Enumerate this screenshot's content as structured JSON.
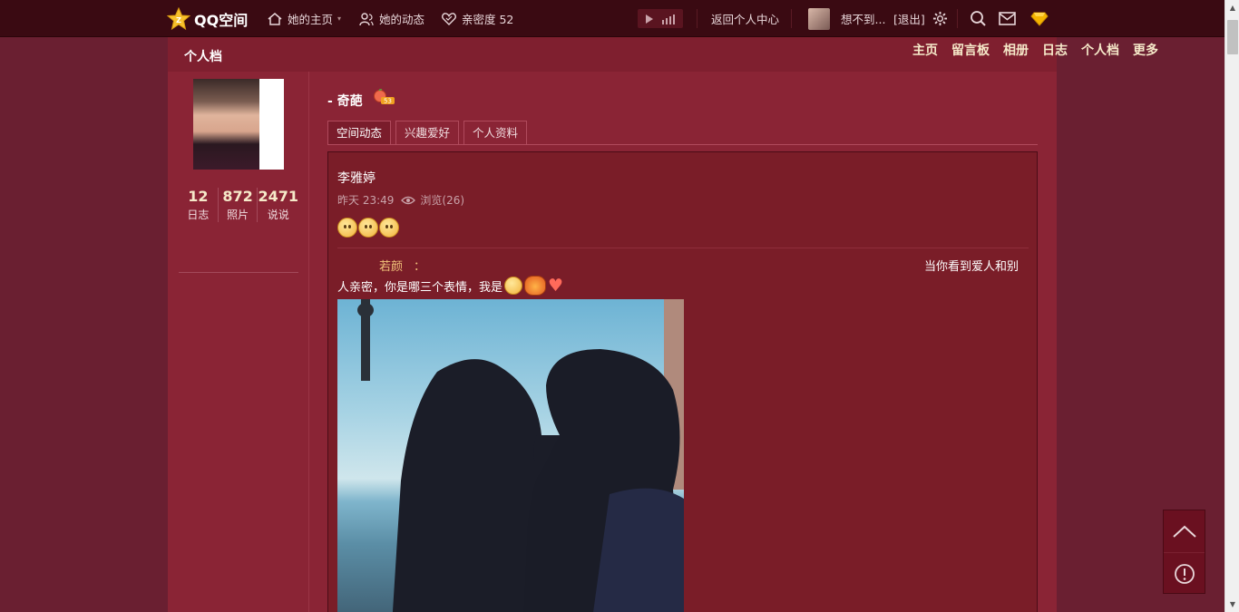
{
  "topbar": {
    "logo_text": "QQ空间",
    "nav": [
      {
        "label": "她的主页",
        "icon": "home-icon",
        "has_dropdown": true
      },
      {
        "label": "她的动态",
        "icon": "people-icon"
      },
      {
        "label": "亲密度 52",
        "icon": "heart-icon"
      }
    ],
    "back_label": "返回个人中心",
    "user_name": "想不到...",
    "logout_label": "[退出]",
    "icons": [
      "play-icon",
      "equalizer-icon",
      "settings-icon",
      "search-icon",
      "mail-icon",
      "diamond-icon"
    ]
  },
  "subnav": {
    "title": "个人档",
    "links": [
      "主页",
      "留言板",
      "相册",
      "日志",
      "个人档",
      "更多"
    ]
  },
  "profile": {
    "stats": [
      {
        "value": "12",
        "label": "日志"
      },
      {
        "value": "872",
        "label": "照片"
      },
      {
        "value": "2471",
        "label": "说说"
      }
    ]
  },
  "content": {
    "name": "- 奇葩",
    "badge": "53",
    "tabs": [
      "空间动态",
      "兴趣爱好",
      "个人资料"
    ],
    "active_tab": 0
  },
  "post": {
    "author": "李雅婷",
    "time": "昨天 23:49",
    "views": "浏览(26)",
    "repost_author": "若颜",
    "repost_colon": "：",
    "repost_text_right": "当你看到爱人和别",
    "repost_text": "人亲密，你是哪三个表情，我是"
  },
  "colors": {
    "accent": "#f6e9c9",
    "background": "#8a2435",
    "topbar": "#3a0a12"
  }
}
